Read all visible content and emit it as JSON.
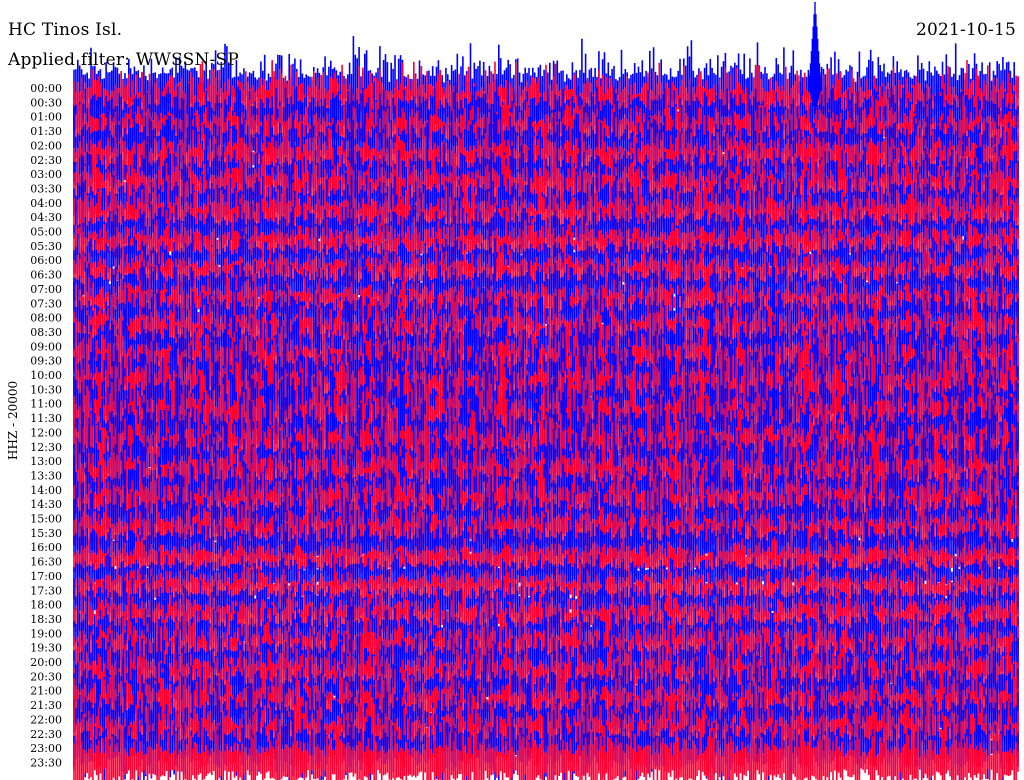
{
  "header": {
    "station": "HC Tinos Isl.",
    "date": "2021-10-15",
    "filter": "Applied filter: WWSSN-SP"
  },
  "axis": {
    "ylabel": "HHZ - 20000"
  },
  "colors": {
    "trace_a": "#0000ff",
    "trace_b": "#ff0033",
    "background": "#ffffff"
  },
  "chart_data": {
    "type": "line",
    "title": "",
    "ylabel": "HHZ - 20000",
    "rows_per_hour": 2,
    "row_minutes": 30,
    "alternating_colors": [
      "#0000ff",
      "#ff0033"
    ],
    "y_ticks": [
      "00:00",
      "00:30",
      "01:00",
      "01:30",
      "02:00",
      "02:30",
      "03:00",
      "03:30",
      "04:00",
      "04:30",
      "05:00",
      "05:30",
      "06:00",
      "06:30",
      "07:00",
      "07:30",
      "08:00",
      "08:30",
      "09:00",
      "09:30",
      "10:00",
      "10:30",
      "11:00",
      "11:30",
      "12:00",
      "12:30",
      "13:00",
      "13:30",
      "14:00",
      "14:30",
      "15:00",
      "15:30",
      "16:00",
      "16:30",
      "17:00",
      "17:30",
      "18:00",
      "18:30",
      "19:00",
      "19:30",
      "20:00",
      "20:30",
      "21:00",
      "21:30",
      "22:00",
      "22:30",
      "23:00",
      "23:30"
    ],
    "row_activity": [
      0.9,
      0.85,
      0.8,
      0.75,
      0.85,
      0.8,
      0.7,
      0.85,
      0.75,
      0.8,
      0.65,
      0.6,
      0.6,
      0.65,
      0.7,
      0.65,
      0.75,
      0.8,
      0.85,
      0.8,
      1.0,
      1.0,
      1.0,
      1.0,
      1.0,
      0.95,
      0.95,
      0.9,
      0.85,
      0.85,
      0.8,
      0.75,
      0.7,
      0.55,
      0.5,
      0.55,
      0.6,
      0.65,
      0.7,
      0.75,
      0.75,
      0.8,
      0.8,
      0.8,
      0.8,
      0.85,
      0.85,
      0.9
    ],
    "events": [
      {
        "row": 0,
        "time_fraction": 0.785,
        "amplitude": 6.0
      }
    ]
  }
}
